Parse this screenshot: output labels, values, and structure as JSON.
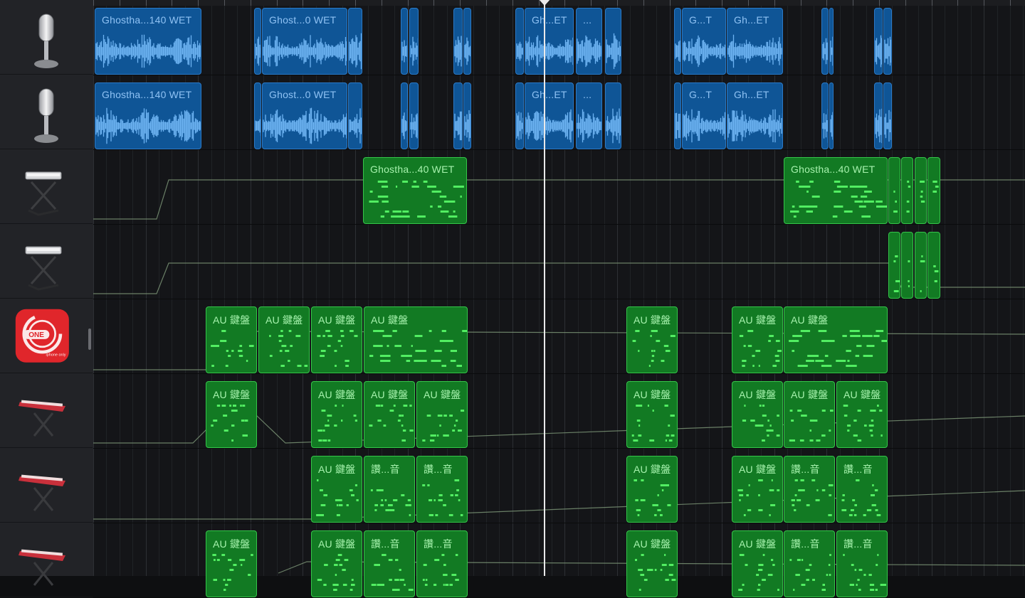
{
  "colors": {
    "audio_region": "#0f5596",
    "audio_waveform": "#6db3f2",
    "midi_region": "#127a23",
    "midi_notes": "#52ee62",
    "automation_line": "#7f9a7a",
    "playhead": "#e9e9ea"
  },
  "tracks": [
    {
      "name": "audio-track-1",
      "icon": "microphone-icon",
      "type": "audio",
      "regions": [
        {
          "label": "Ghostha...140 WET"
        },
        {
          "label": ""
        },
        {
          "label": "Ghost...0 WET"
        },
        {
          "label": ""
        },
        {
          "label": ""
        },
        {
          "label": ""
        },
        {
          "label": ""
        },
        {
          "label": ""
        },
        {
          "label": ""
        },
        {
          "label": "Gh...ET"
        },
        {
          "label": "..."
        },
        {
          "label": ""
        },
        {
          "label": ""
        },
        {
          "label": "G...T"
        },
        {
          "label": "Gh...ET"
        },
        {
          "label": ""
        },
        {
          "label": ""
        },
        {
          "label": ""
        },
        {
          "label": ""
        }
      ]
    },
    {
      "name": "audio-track-2",
      "icon": "microphone-icon",
      "type": "audio",
      "regions": [
        {
          "label": "Ghostha...140 WET"
        },
        {
          "label": ""
        },
        {
          "label": "Ghost...0 WET"
        },
        {
          "label": ""
        },
        {
          "label": ""
        },
        {
          "label": ""
        },
        {
          "label": ""
        },
        {
          "label": ""
        },
        {
          "label": ""
        },
        {
          "label": "Gh...ET"
        },
        {
          "label": "..."
        },
        {
          "label": ""
        },
        {
          "label": ""
        },
        {
          "label": "G...T"
        },
        {
          "label": "Gh...ET"
        },
        {
          "label": ""
        },
        {
          "label": ""
        },
        {
          "label": ""
        },
        {
          "label": ""
        }
      ]
    },
    {
      "name": "keyboard-track-1",
      "icon": "keyboard-stand-icon",
      "type": "midi",
      "regions": [
        {
          "label": "Ghostha...40 WET"
        },
        {
          "label": "Ghostha...40 WET"
        },
        {
          "label": ""
        },
        {
          "label": ""
        },
        {
          "label": ""
        },
        {
          "label": ""
        }
      ]
    },
    {
      "name": "keyboard-track-2",
      "icon": "keyboard-stand-icon",
      "type": "midi",
      "regions": [
        {
          "label": ""
        },
        {
          "label": ""
        },
        {
          "label": ""
        },
        {
          "label": ""
        }
      ]
    },
    {
      "name": "one-app-track",
      "icon": "one-app-icon",
      "icon_text": "ONE",
      "icon_subtext": "iphone only",
      "type": "midi",
      "regions": [
        {
          "label": "AU 鍵盤"
        },
        {
          "label": "AU 鍵盤"
        },
        {
          "label": "AU 鍵盤"
        },
        {
          "label": "AU 鍵盤"
        },
        {
          "label": "AU 鍵盤"
        },
        {
          "label": "AU 鍵盤"
        },
        {
          "label": "AU 鍵盤"
        }
      ]
    },
    {
      "name": "red-keyboard-track-1",
      "icon": "red-keyboard-icon",
      "type": "midi",
      "regions": [
        {
          "label": "AU 鍵盤"
        },
        {
          "label": "AU 鍵盤"
        },
        {
          "label": "AU 鍵盤"
        },
        {
          "label": "AU 鍵盤"
        },
        {
          "label": "AU 鍵盤"
        },
        {
          "label": "AU 鍵盤"
        },
        {
          "label": "AU 鍵盤"
        },
        {
          "label": "AU 鍵盤"
        }
      ]
    },
    {
      "name": "red-keyboard-track-2",
      "icon": "red-keyboard-icon",
      "type": "midi",
      "regions": [
        {
          "label": "AU 鍵盤"
        },
        {
          "label": "讚...音"
        },
        {
          "label": "讚...音"
        },
        {
          "label": "AU 鍵盤"
        },
        {
          "label": "AU 鍵盤"
        },
        {
          "label": "讚...音"
        },
        {
          "label": "讚...音"
        }
      ]
    },
    {
      "name": "red-keyboard-track-3",
      "icon": "red-keyboard-icon",
      "type": "midi",
      "regions": [
        {
          "label": "AU 鍵盤"
        },
        {
          "label": "AU 鍵盤"
        },
        {
          "label": "讚...音"
        },
        {
          "label": "讚...音"
        },
        {
          "label": "AU 鍵盤"
        },
        {
          "label": "AU 鍵盤"
        },
        {
          "label": "讚...音"
        },
        {
          "label": "讚...音"
        }
      ]
    }
  ]
}
